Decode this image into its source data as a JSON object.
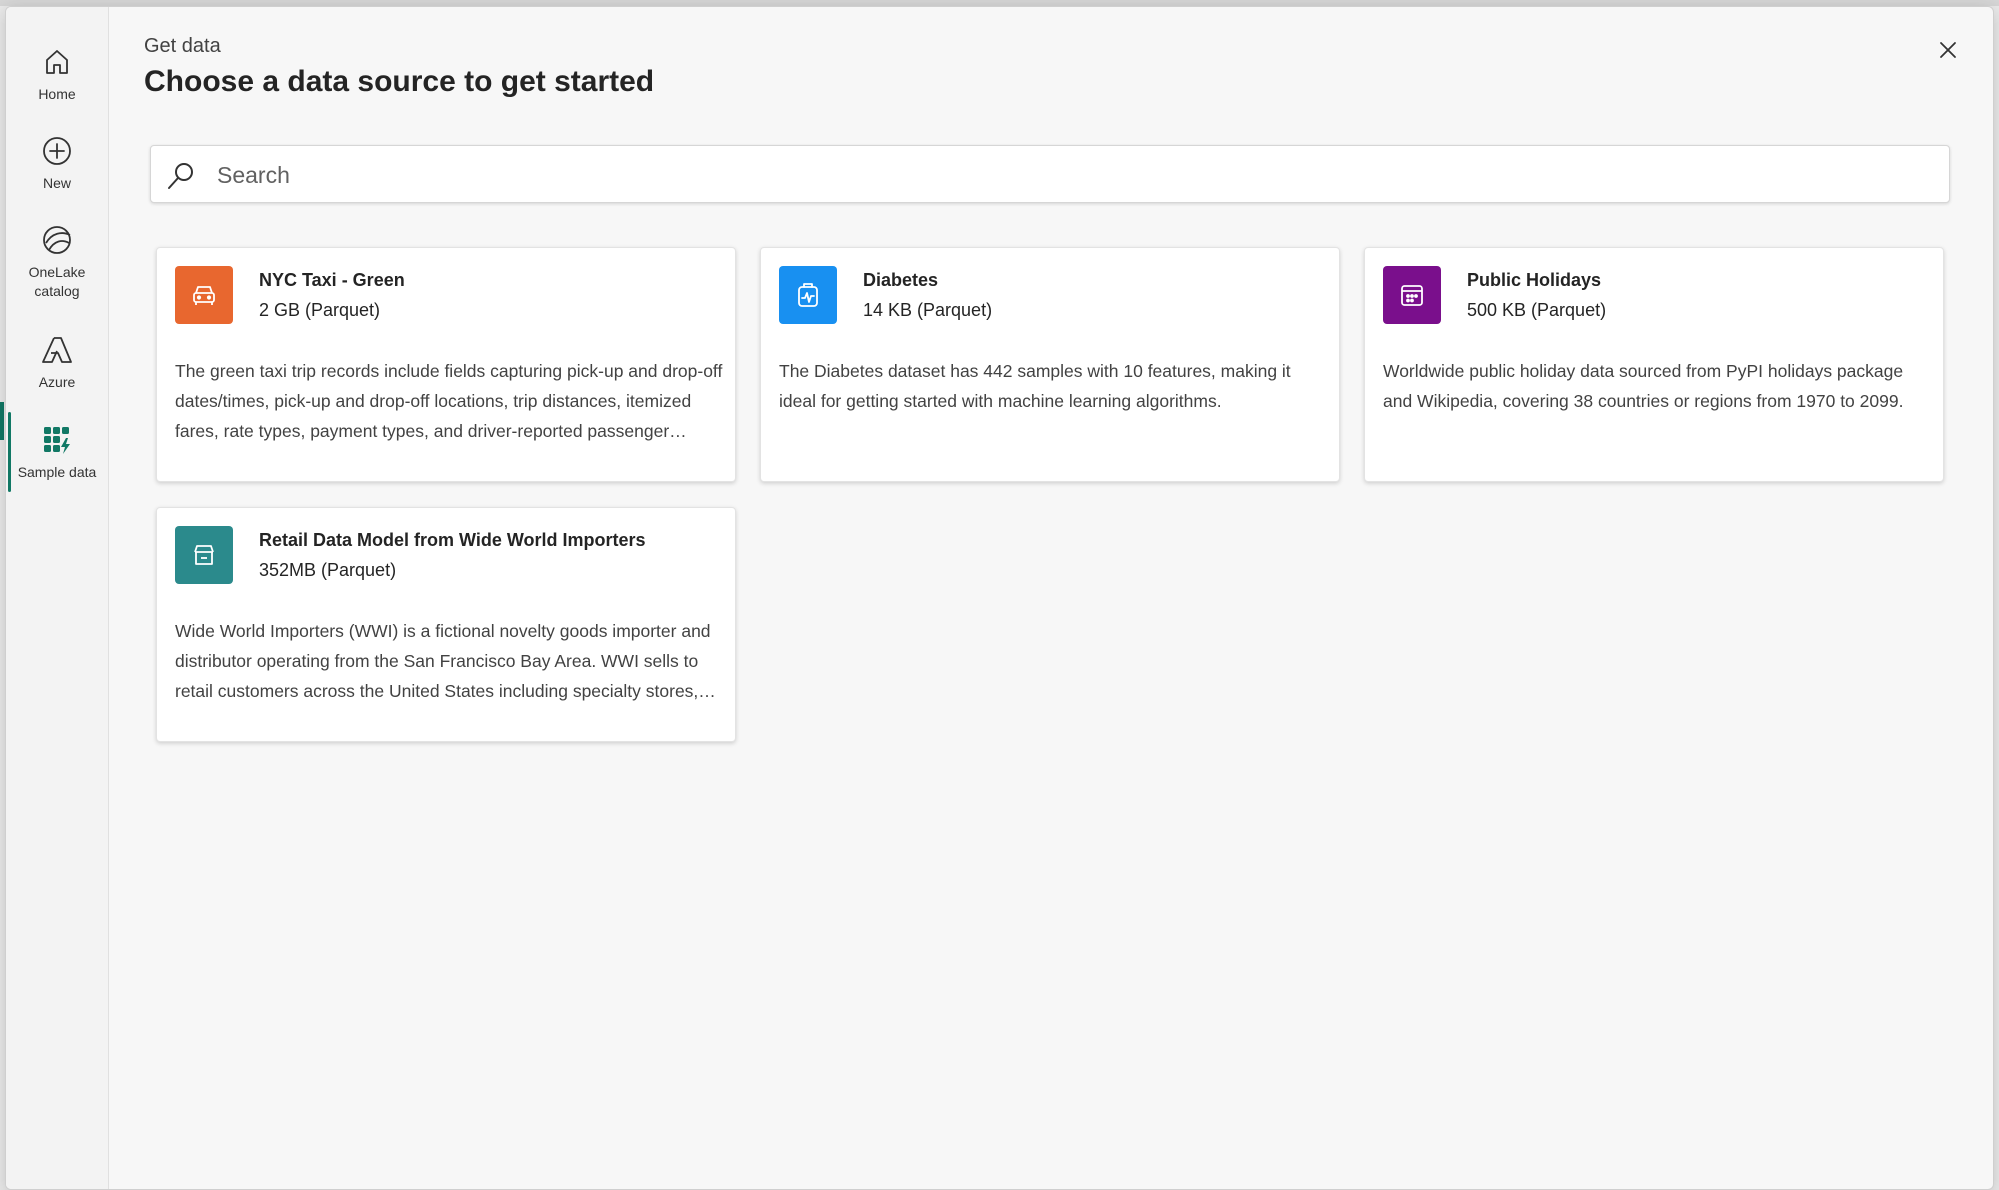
{
  "nav": {
    "items": [
      {
        "label": "Home",
        "icon": "home-icon"
      },
      {
        "label": "New",
        "icon": "plus-circle-icon"
      },
      {
        "label": "OneLake catalog",
        "icon": "onelake-icon"
      },
      {
        "label": "Azure",
        "icon": "azure-icon"
      },
      {
        "label": "Sample data",
        "icon": "sample-data-icon",
        "selected": true
      }
    ]
  },
  "header": {
    "eyebrow": "Get data",
    "title": "Choose a data source to get started"
  },
  "search": {
    "placeholder": "Search",
    "value": ""
  },
  "cards": [
    {
      "title": "NYC Taxi - Green",
      "size": "2 GB (Parquet)",
      "description": "The green taxi trip records include fields capturing pick-up and drop-off dates/times, pick-up and drop-off locations, trip distances, itemized fares, rate types, payment types, and driver-reported passenger counts.",
      "icon": "car-icon",
      "color": "#e8672f"
    },
    {
      "title": "Diabetes",
      "size": "14 KB (Parquet)",
      "description": "The Diabetes dataset has 442 samples with 10 features, making it ideal for getting started with machine learning algorithms.",
      "icon": "health-icon",
      "color": "#1890f1"
    },
    {
      "title": "Public Holidays",
      "size": "500 KB (Parquet)",
      "description": "Worldwide public holiday data sourced from PyPI holidays package and Wikipedia, covering 38 countries or regions from 1970 to 2099.",
      "icon": "calendar-icon",
      "color": "#7a0f8c"
    },
    {
      "title": "Retail Data Model from Wide World Importers",
      "size": "352MB (Parquet)",
      "description": "Wide World Importers (WWI) is a fictional novelty goods importer and distributor operating from the San Francisco Bay Area. WWI sells to retail customers across the United States including specialty stores, supermarkets, and individual customers.",
      "icon": "store-icon",
      "color": "#2b8a8c"
    }
  ],
  "colors": {
    "accent": "#117865"
  }
}
